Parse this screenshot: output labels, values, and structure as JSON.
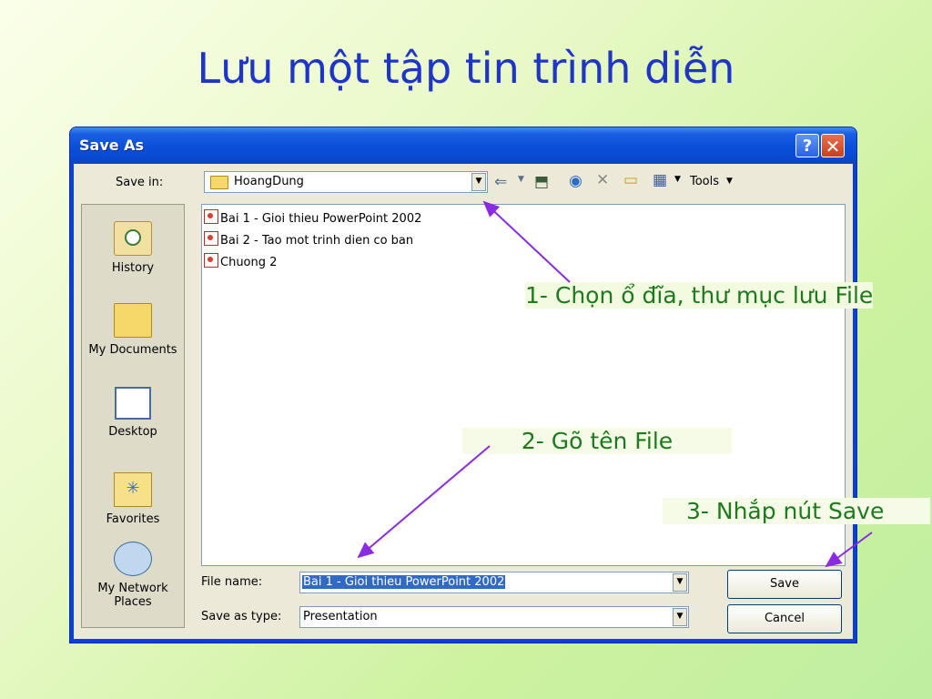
{
  "slide": {
    "title": "Lưu một tập tin trình diễn"
  },
  "dialog": {
    "title": "Save As",
    "help_label": "?",
    "close_label": "✕",
    "save_in_label": "Save in:",
    "save_in_value": "HoangDung",
    "tools_label": "Tools",
    "places": [
      {
        "label": "History",
        "icon": "history-icon"
      },
      {
        "label": "My Documents",
        "icon": "my-documents-icon"
      },
      {
        "label": "Desktop",
        "icon": "desktop-icon"
      },
      {
        "label": "Favorites",
        "icon": "favorites-icon"
      },
      {
        "label": "My Network Places",
        "icon": "network-places-icon"
      }
    ],
    "files": [
      "Bai 1 - Gioi thieu PowerPoint 2002",
      "Bai 2 - Tao mot trinh dien co ban",
      "Chuong 2"
    ],
    "file_name_label": "File name:",
    "file_name_value": "Bai 1 - Gioi thieu PowerPoint 2002",
    "save_as_type_label": "Save as type:",
    "save_as_type_value": "Presentation",
    "save_button": "Save",
    "cancel_button": "Cancel"
  },
  "annotations": {
    "step1": "1- Chọn ổ đĩa, thư mục lưu File",
    "step2": "2- Gõ tên File",
    "step3": "3- Nhắp nút Save"
  },
  "colors": {
    "title": "#1f35c8",
    "annotation_text": "#1d7a1d",
    "arrow": "#8a2be2",
    "dialog_frame": "#0a49cf"
  }
}
